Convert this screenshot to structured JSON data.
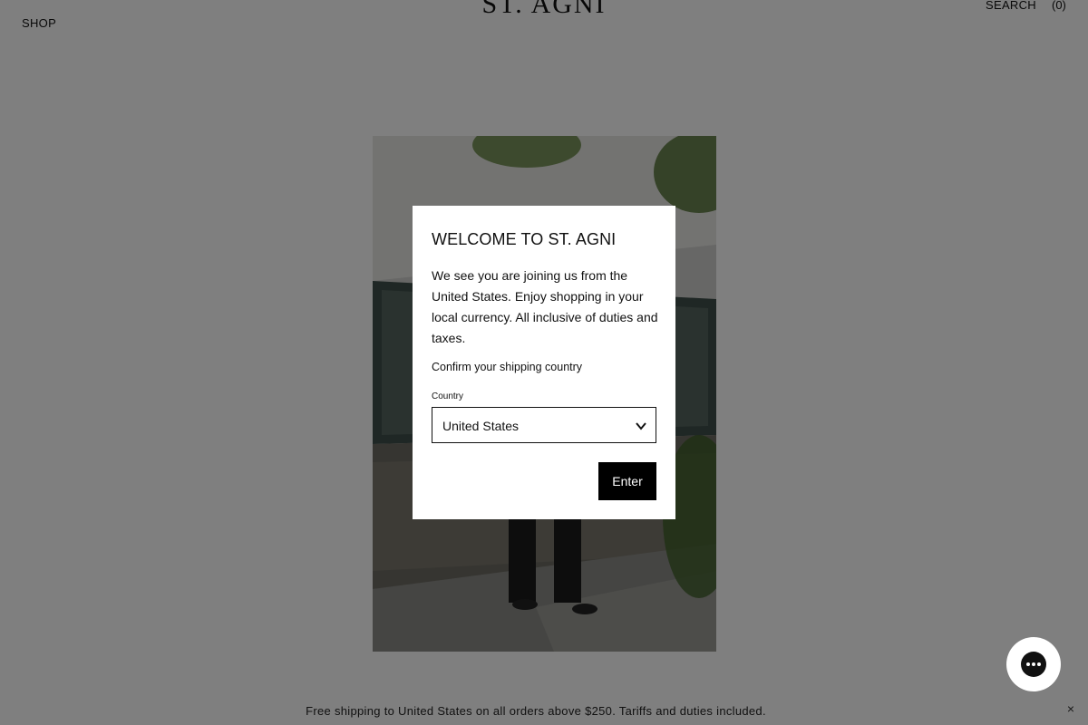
{
  "header": {
    "shop_label": "SHOP",
    "logo_text": "ST. AGNI",
    "search_label": "SEARCH",
    "cart_label": "(0)"
  },
  "announcement": {
    "text": "Free shipping to United States on all orders above $250. Tariffs and duties included.",
    "close_glyph": "×"
  },
  "modal": {
    "title": "WELCOME TO ST. AGNI",
    "body": "We see you are joining us from the United States. Enjoy shopping in your local currency. All inclusive of duties and taxes.",
    "confirm_text": "Confirm your shipping country",
    "country_label": "Country",
    "country_value": "United States",
    "enter_label": "Enter"
  },
  "chat": {
    "icon": "chat-bubble-icon"
  },
  "colors": {
    "overlay": "rgba(0,0,0,0.5)",
    "button_bg": "#000000",
    "modal_bg": "#ffffff"
  }
}
